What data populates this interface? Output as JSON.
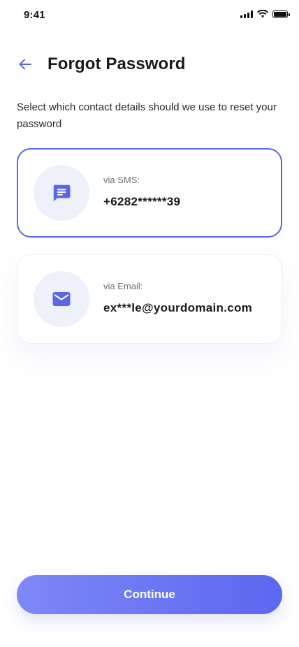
{
  "status_bar": {
    "time": "9:41"
  },
  "header": {
    "title": "Forgot Password"
  },
  "instruction": "Select which contact details should we use to reset your password",
  "options": [
    {
      "label": "via SMS:",
      "value": "+6282******39",
      "icon": "message-icon",
      "selected": true
    },
    {
      "label": "via Email:",
      "value": "ex***le@yourdomain.com",
      "icon": "mail-icon",
      "selected": false
    }
  ],
  "continue_label": "Continue",
  "colors": {
    "accent": "#5b67e3",
    "button_gradient_start": "#7e88f7",
    "button_gradient_end": "#5b67ef",
    "icon_bg": "#eef0fb"
  }
}
